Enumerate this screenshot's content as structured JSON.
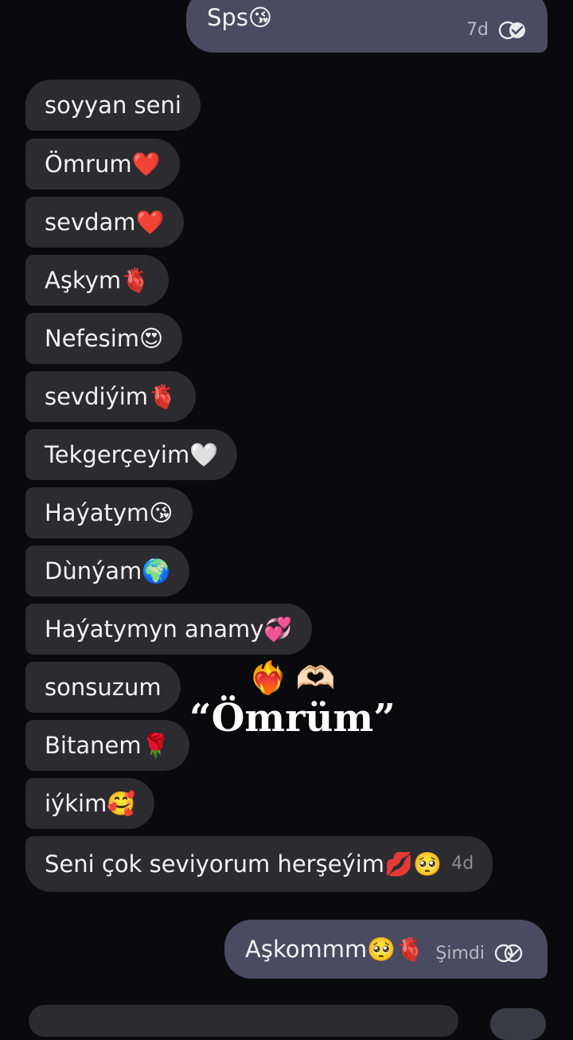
{
  "conversation": {
    "sent_top": {
      "text": "Sps😘",
      "time": "7d"
    },
    "received": [
      "soyyan seni",
      "Ömrum❤️",
      "sevdam❤️",
      "Aşkym🫀",
      "Nefesim😍",
      "sevdiýim🫀",
      "Tekgerçeyim🤍",
      "Haýatym😘",
      "Dùnýam🌍",
      "Haýatymyn anamy💞",
      "sonsuzum",
      "Bitanem🌹",
      "iýkim🥰",
      "Seni çok seviyorum herşeýim💋🥺"
    ],
    "received_last_time": "4d",
    "sent_bottom": {
      "text": "Aşkommm🥺🫀",
      "time": "Şimdi"
    }
  },
  "overlay": {
    "emojis": "❤️‍🔥🫶🏻",
    "title": "“Ömrüm”"
  },
  "icons": {
    "read_receipt": "double-check-icon"
  },
  "colors": {
    "background": "#0a0a0c",
    "received_bubble": "#2b2b30",
    "sent_bubble": "#4a4a60"
  }
}
